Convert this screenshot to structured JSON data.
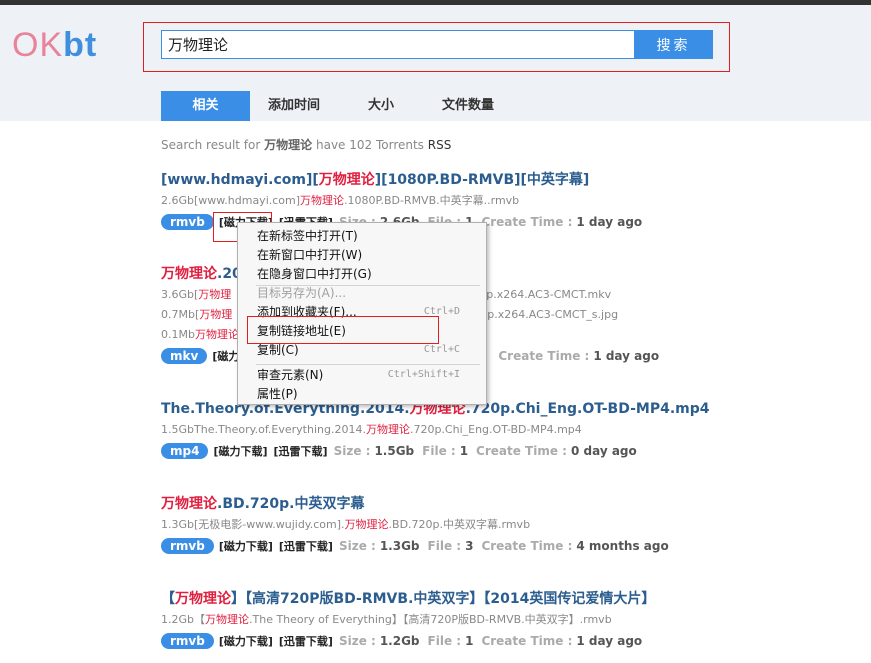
{
  "logo": {
    "ok": "OK",
    "bt": "bt"
  },
  "search": {
    "value": "万物理论",
    "button": "搜索"
  },
  "tabs": [
    {
      "label": "相关",
      "active": true
    },
    {
      "label": "添加时间"
    },
    {
      "label": "大小"
    },
    {
      "label": "文件数量"
    }
  ],
  "summary": {
    "prefix": "Search result for",
    "query": "万物理论",
    "middle": "have 102 Torrents",
    "rss": "RSS"
  },
  "labels": {
    "magnet": "[磁力下载]",
    "thunder": "[迅雷下载]",
    "size": "Size :",
    "file": "File :",
    "create": "Create Time :"
  },
  "results": [
    {
      "title": [
        "[www.hdmayi.com][",
        "万物理论",
        "][1080P.BD-RMVB][中英字幕]"
      ],
      "files": [
        [
          "2.6Gb[www.hdmayi.com]",
          "万物理论",
          ".1080P.BD-RMVB.中英字幕..rmvb"
        ]
      ],
      "badge": "rmvb",
      "size": "2.6Gb",
      "count": "1",
      "time": "1 day ago"
    },
    {
      "title": [
        "",
        "万物理论",
        ".20"
      ],
      "files": [
        [
          "3.6Gb[",
          "万物理",
          ""
        ],
        [
          "0.7Mb[",
          "万物理",
          ""
        ],
        [
          "0.1Mb",
          "万物理论",
          ""
        ]
      ],
      "file_tails": [
        "0p.x264.AC3-CMCT.mkv",
        "0p.x264.AC3-CMCT_s.jpg"
      ],
      "badge": "mkv",
      "size": "",
      "count": "",
      "time": "1 day ago"
    },
    {
      "title": [
        "The.Theory.of.Everything.2014.",
        "万物理论",
        ".720p.Chi_Eng.OT-BD-MP4.mp4"
      ],
      "files": [
        [
          "1.5GbThe.Theory.of.Everything.2014.",
          "万物理论",
          ".720p.Chi_Eng.OT-BD-MP4.mp4"
        ]
      ],
      "badge": "mp4",
      "size": "1.5Gb",
      "count": "1",
      "time": "0 day ago"
    },
    {
      "title": [
        "",
        "万物理论",
        ".BD.720p.中英双字幕"
      ],
      "files": [
        [
          "1.3Gb[无极电影-www.wujidy.com].",
          "万物理论",
          ".BD.720p.中英双字幕.rmvb"
        ]
      ],
      "badge": "rmvb",
      "size": "1.3Gb",
      "count": "3",
      "time": "4 months ago"
    },
    {
      "title": [
        "【",
        "万物理论",
        "】【高清720P版BD-RMVB.中英双字】【2014英国传记爱情大片】"
      ],
      "files": [
        [
          "1.2Gb【",
          "万物理论",
          ".The Theory of Everything】【高清720P版BD-RMVB.中英双字】.rmvb"
        ]
      ],
      "badge": "rmvb",
      "size": "1.2Gb",
      "count": "1",
      "time": "1 day ago"
    }
  ],
  "first_meta_partial": {
    "size": "2.6Gb",
    "file": "File :",
    "count": "1",
    "create": "Create Time :"
  },
  "context_menu": {
    "items": [
      {
        "label": "在新标签中打开(T)",
        "shortcut": ""
      },
      {
        "label": "在新窗口中打开(W)",
        "shortcut": ""
      },
      {
        "label": "在隐身窗口中打开(G)",
        "shortcut": ""
      },
      {
        "label": "目标另存为(A)...",
        "shortcut": "",
        "disabled": true
      },
      {
        "label": "添加到收藏夹(F)...",
        "shortcut": "Ctrl+D"
      },
      {
        "label": "复制链接地址(E)",
        "shortcut": ""
      },
      {
        "label": "复制(C)",
        "shortcut": "Ctrl+C"
      },
      {
        "label": "审查元素(N)",
        "shortcut": "Ctrl+Shift+I"
      },
      {
        "label": "属性(P)",
        "shortcut": ""
      }
    ]
  },
  "colors": {
    "accent": "#3b8ee5",
    "highlight": "#e02040",
    "title": "#2c5d8f"
  }
}
